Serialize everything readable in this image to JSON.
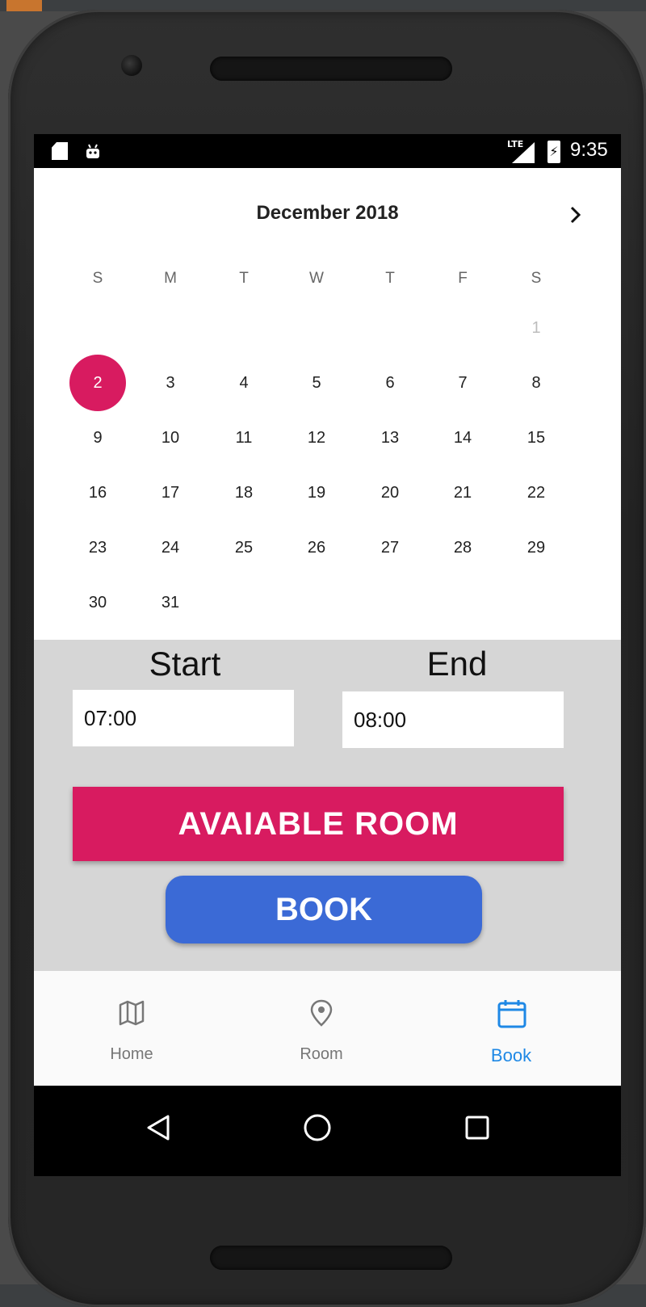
{
  "status_bar": {
    "time": "9:35",
    "network": "LTE",
    "icons": [
      "sd-card-icon",
      "android-icon",
      "signal-icon",
      "battery-charging-icon"
    ]
  },
  "calendar": {
    "month_title": "December 2018",
    "next_icon": "chevron-right-icon",
    "weekdays": [
      "S",
      "M",
      "T",
      "W",
      "T",
      "F",
      "S"
    ],
    "prev_month_day": "1",
    "selected_day": "2",
    "days": [
      "3",
      "4",
      "5",
      "6",
      "7",
      "8",
      "9",
      "10",
      "11",
      "12",
      "13",
      "14",
      "15",
      "16",
      "17",
      "18",
      "19",
      "20",
      "21",
      "22",
      "23",
      "24",
      "25",
      "26",
      "27",
      "28",
      "29",
      "30",
      "31"
    ]
  },
  "time_range": {
    "start_label": "Start",
    "start_value": "07:00",
    "end_label": "End",
    "end_value": "08:00"
  },
  "actions": {
    "available_room_label": "AVAIABLE ROOM",
    "book_label": "BOOK",
    "available_room_color": "#d81b60",
    "book_color": "#3b6ad6"
  },
  "bottom_nav": {
    "items": [
      {
        "label": "Home",
        "icon": "map-icon"
      },
      {
        "label": "Room",
        "icon": "location-pin-icon"
      },
      {
        "label": "Book",
        "icon": "calendar-icon"
      }
    ],
    "active": "Book",
    "active_color": "#1e88e5"
  },
  "system_nav": {
    "icons": [
      "back-icon",
      "home-circle-icon",
      "recents-square-icon"
    ]
  }
}
